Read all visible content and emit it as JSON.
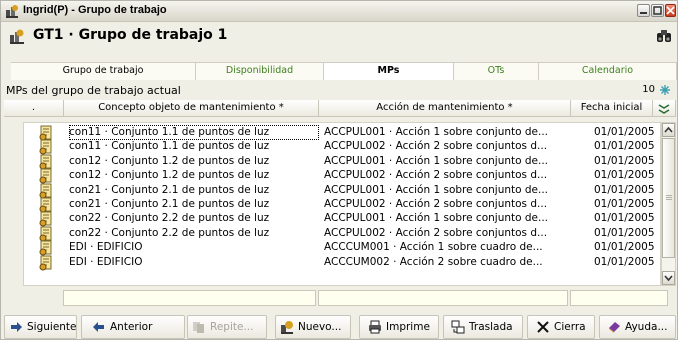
{
  "window": {
    "title": "Ingrid(P) - Grupo de trabajo"
  },
  "header": {
    "title": "GT1 · Grupo de trabajo 1"
  },
  "tabs": [
    {
      "label": "Grupo de trabajo"
    },
    {
      "label": "Disponibilidad"
    },
    {
      "label": "MPs"
    },
    {
      "label": "OTs"
    },
    {
      "label": "Calendario"
    }
  ],
  "section": {
    "title": "MPs del grupo de trabajo actual",
    "count": "10"
  },
  "columns": [
    {
      "label": "."
    },
    {
      "label": "Concepto objeto de mantenimiento *"
    },
    {
      "label": "Acción de mantenimiento *"
    },
    {
      "label": "Fecha inicial"
    }
  ],
  "rows": [
    {
      "concept": "con11 · Conjunto 1.1 de puntos de luz",
      "action": "ACCPUL001 · Acción 1 sobre conjunto de...",
      "date": "01/01/2005"
    },
    {
      "concept": "con11 · Conjunto 1.1 de puntos de luz",
      "action": "ACCPUL002 · Acción 2 sobre conjuntos d...",
      "date": "01/01/2005"
    },
    {
      "concept": "con12 · Conjunto 1.2 de puntos de luz",
      "action": "ACCPUL001 · Acción 1 sobre conjunto de...",
      "date": "01/01/2005"
    },
    {
      "concept": "con12 · Conjunto 1.2 de puntos de luz",
      "action": "ACCPUL002 · Acción 2 sobre conjuntos d...",
      "date": "01/01/2005"
    },
    {
      "concept": "con21 · Conjunto 2.1 de puntos de luz",
      "action": "ACCPUL001 · Acción 1 sobre conjunto de...",
      "date": "01/01/2005"
    },
    {
      "concept": "con21 · Conjunto 2.1 de puntos de luz",
      "action": "ACCPUL002 · Acción 2 sobre conjuntos d...",
      "date": "01/01/2005"
    },
    {
      "concept": "con22 · Conjunto 2.2 de puntos de luz",
      "action": "ACCPUL001 · Acción 1 sobre conjunto de...",
      "date": "01/01/2005"
    },
    {
      "concept": "con22 · Conjunto 2.2 de puntos de luz",
      "action": "ACCPUL002 · Acción 2 sobre conjuntos d...",
      "date": "01/01/2005"
    },
    {
      "concept": "EDI · EDIFICIO",
      "action": "ACCCUM001 · Acción 1 sobre cuadro de...",
      "date": "01/01/2005"
    },
    {
      "concept": "EDI · EDIFICIO",
      "action": "ACCCUM002 · Acción 2 sobre cuadro de...",
      "date": "01/01/2005"
    }
  ],
  "toolbar": {
    "siguiente": "Siguiente",
    "anterior": "Anterior",
    "repite": "Repite...",
    "nuevo": "Nuevo...",
    "imprime": "Imprime",
    "traslada": "Traslada",
    "cierra": "Cierra",
    "ayuda": "Ayuda..."
  },
  "colors": {
    "tab_green": "#3e7f1e",
    "filter_bg": "#fffff0",
    "refresh_icon": "#3fa0b0"
  },
  "icons": {
    "title": "app-icon",
    "header": "app-icon",
    "search": "binoculars-icon",
    "refresh": "refresh-icon",
    "settings": "column-settings-icon",
    "row": "maintenance-plan-icon"
  }
}
